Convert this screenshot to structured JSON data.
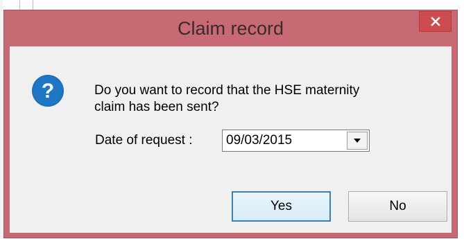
{
  "dialog": {
    "title": "Claim record",
    "close_glyph": "×"
  },
  "icons": {
    "close": "close-icon",
    "question": "question-icon",
    "dropdown": "chevron-down-icon"
  },
  "message": {
    "text": "Do you want to record that the HSE maternity claim has been sent?"
  },
  "date_field": {
    "label": "Date of request :",
    "value": "09/03/2015"
  },
  "buttons": {
    "yes_label": "Yes",
    "no_label": "No"
  },
  "colors": {
    "titlebar": "#c86a73",
    "close_button": "#cd4d4f",
    "client_area": "#f0f0f0",
    "icon_blue": "#1c6fb8",
    "default_button_border": "#3c7fb1"
  }
}
